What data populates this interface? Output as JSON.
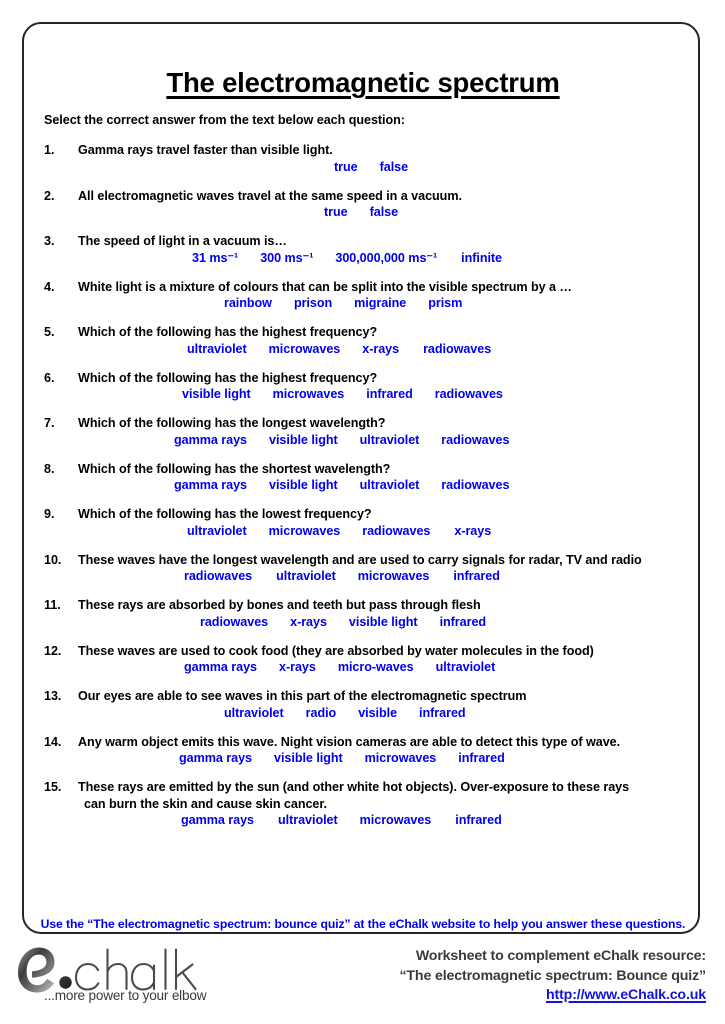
{
  "title": "The electromagnetic spectrum",
  "instruction": "Select the correct answer from the text below each question:",
  "accent_blue": "#0000ee",
  "border_color": "#262626",
  "questions": [
    {
      "num": "1.",
      "text": "Gamma rays travel faster than visible light.",
      "options": [
        "true",
        "false"
      ],
      "answer_indent": 310,
      "gaps": [
        22
      ]
    },
    {
      "num": "2.",
      "text": "All electromagnetic waves travel at the same speed in a vacuum.",
      "options": [
        "true",
        "false"
      ],
      "answer_indent": 300,
      "gaps": [
        22
      ]
    },
    {
      "num": "3.",
      "text": "The speed of light in a vacuum is…",
      "options": [
        "31 ms⁻¹",
        "300 ms⁻¹",
        "300,000,000 ms⁻¹",
        "infinite"
      ],
      "answer_indent": 168,
      "gaps": [
        22,
        22,
        24
      ]
    },
    {
      "num": "4.",
      "text": "White light is a mixture of colours that can be split into the visible spectrum by a …",
      "options": [
        "rainbow",
        "prison",
        "migraine",
        "prism"
      ],
      "answer_indent": 200,
      "gaps": [
        22,
        22,
        22
      ]
    },
    {
      "num": "5.",
      "text": "Which of the following has the highest frequency?",
      "options": [
        "ultraviolet",
        "microwaves",
        "x-rays",
        "radiowaves"
      ],
      "answer_indent": 163,
      "gaps": [
        22,
        22,
        24
      ]
    },
    {
      "num": "6.",
      "text": " Which of the following has the highest frequency?",
      "options": [
        "visible light",
        "microwaves",
        "infrared",
        "radiowaves"
      ],
      "answer_indent": 158,
      "gaps": [
        22,
        22,
        22
      ]
    },
    {
      "num": "7.",
      "text": "Which of the following has the longest wavelength?",
      "options": [
        "gamma rays",
        "visible light",
        "ultraviolet",
        "radiowaves"
      ],
      "answer_indent": 150,
      "gaps": [
        22,
        22,
        22
      ]
    },
    {
      "num": "8.",
      "text": "Which of the following has the shortest wavelength?",
      "options": [
        "gamma rays",
        "visible light",
        "ultraviolet",
        "radiowaves"
      ],
      "answer_indent": 150,
      "gaps": [
        22,
        22,
        22
      ]
    },
    {
      "num": "9.",
      "text": "Which of the following has the lowest frequency?",
      "options": [
        "ultraviolet",
        "microwaves",
        "radiowaves",
        "x-rays"
      ],
      "answer_indent": 163,
      "gaps": [
        22,
        22,
        24
      ]
    },
    {
      "num": "10.",
      "text": "These waves have the longest wavelength and are used to carry signals for radar, TV and radio",
      "options": [
        "radiowaves",
        "ultraviolet",
        "microwaves",
        "infrared"
      ],
      "answer_indent": 160,
      "gaps": [
        24,
        22,
        24
      ]
    },
    {
      "num": "11.",
      "text": "These rays are absorbed by bones and teeth but pass through flesh",
      "options": [
        "radiowaves",
        "x-rays",
        "visible light",
        "infrared"
      ],
      "answer_indent": 176,
      "gaps": [
        22,
        22,
        22
      ]
    },
    {
      "num": "12.",
      "text": "These waves are used to cook food (they are absorbed by water molecules in the food)",
      "options": [
        "gamma rays",
        "x-rays",
        "micro-waves",
        "ultraviolet"
      ],
      "answer_indent": 160,
      "gaps": [
        22,
        22,
        22
      ]
    },
    {
      "num": "13.",
      "text": "Our eyes are able to see waves in this part of the electromagnetic spectrum",
      "options": [
        "ultraviolet",
        "radio",
        "visible",
        "infrared"
      ],
      "answer_indent": 200,
      "gaps": [
        22,
        22,
        22
      ]
    },
    {
      "num": "14.",
      "text": "Any warm object emits this wave. Night vision cameras are able to detect this type of wave.",
      "options": [
        "gamma rays",
        "visible light",
        "microwaves",
        "infrared"
      ],
      "answer_indent": 155,
      "gaps": [
        22,
        22,
        22
      ]
    },
    {
      "num": "15.",
      "text": "These rays are emitted by the sun (and other white hot objects). Over-exposure to these rays",
      "text_line2": "can burn the skin and cause skin cancer.",
      "options": [
        "gamma rays",
        "ultraviolet",
        "microwaves",
        "infrared"
      ],
      "answer_indent": 157,
      "gaps": [
        24,
        22,
        24
      ]
    }
  ],
  "bounce_note": "Use the “The electromagnetic spectrum: bounce quiz” at the eChalk website to help you answer these questions.",
  "footer": {
    "logo_text": "e·chalk",
    "logo_e": "e",
    "logo_word": "chalk",
    "tagline": "...more power to your elbow",
    "line1": "Worksheet to complement eChalk resource:",
    "line2": "“The electromagnetic spectrum: Bounce quiz”",
    "url": "http://www.eChalk.co.uk"
  }
}
